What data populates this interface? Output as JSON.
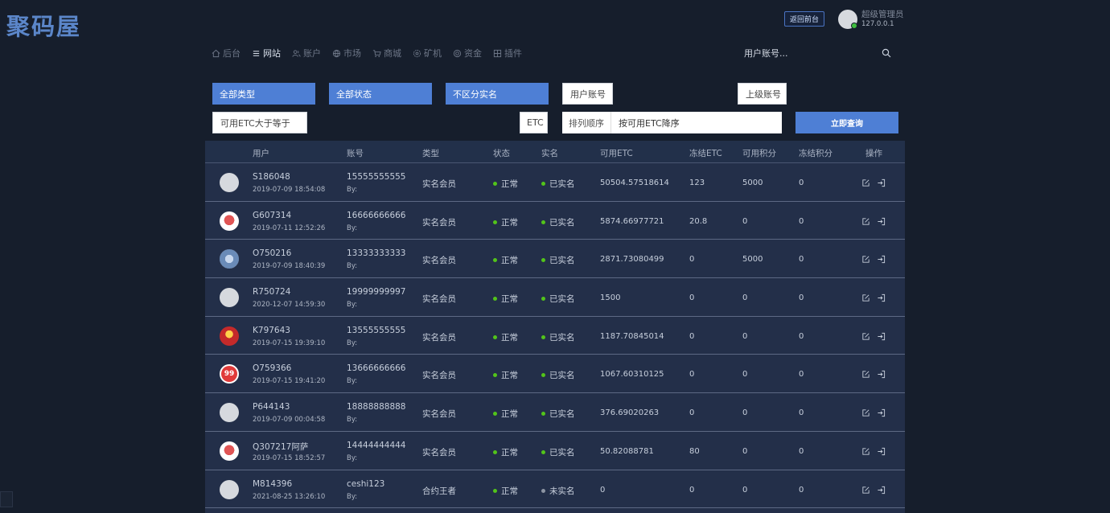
{
  "brand": {
    "logo": "聚码屋"
  },
  "header": {
    "back_button": "返回前台",
    "admin_name": "超级管理员",
    "admin_ip": "127.0.0.1"
  },
  "nav": {
    "items": [
      {
        "label": "后台",
        "icon": "home-icon",
        "active": false
      },
      {
        "label": "网站",
        "icon": "list-icon",
        "active": true
      },
      {
        "label": "账户",
        "icon": "users-icon",
        "active": false
      },
      {
        "label": "市场",
        "icon": "globe-icon",
        "active": false
      },
      {
        "label": "商城",
        "icon": "cart-icon",
        "active": false
      },
      {
        "label": "矿机",
        "icon": "gear-icon",
        "active": false
      },
      {
        "label": "资金",
        "icon": "coin-icon",
        "active": false
      },
      {
        "label": "插件",
        "icon": "grid-icon",
        "active": false
      }
    ],
    "user_search": "用户账号..."
  },
  "filters": {
    "type": "全部类型",
    "status": "全部状态",
    "realname": "不区分实名",
    "user_account_placeholder": "用户账号",
    "parent_account_placeholder": "上级账号",
    "etc_min_placeholder": "可用ETC大于等于",
    "etc_unit": "ETC",
    "sort_label": "排列顺序",
    "sort_value": "按可用ETC降序",
    "query_button": "立即查询"
  },
  "table": {
    "headers": {
      "user": "用户",
      "account": "账号",
      "type": "类型",
      "status": "状态",
      "realname": "实名",
      "etc": "可用ETC",
      "frozen_etc": "冻结ETC",
      "points": "可用积分",
      "frozen_points": "冻结积分",
      "actions": "操作"
    },
    "rows": [
      {
        "name": "S186048",
        "date": "2019-07-09 18:54:08",
        "account": "15555555555",
        "by": "By:",
        "type": "实名会员",
        "status": "正常",
        "realname": "已实名",
        "verified": true,
        "etc": "50504.57518614",
        "frozen": "123",
        "points": "5000",
        "fpoints": "0"
      },
      {
        "name": "G607314",
        "date": "2019-07-11 12:52:26",
        "account": "16666666666",
        "by": "By:",
        "type": "实名会员",
        "status": "正常",
        "realname": "已实名",
        "verified": true,
        "etc": "5874.66977721",
        "frozen": "20.8",
        "points": "0",
        "fpoints": "0"
      },
      {
        "name": "O750216",
        "date": "2019-07-09 18:40:39",
        "account": "13333333333",
        "by": "By:",
        "type": "实名会员",
        "status": "正常",
        "realname": "已实名",
        "verified": true,
        "etc": "2871.73080499",
        "frozen": "0",
        "points": "5000",
        "fpoints": "0"
      },
      {
        "name": "R750724",
        "date": "2020-12-07 14:59:30",
        "account": "19999999997",
        "by": "By:",
        "type": "实名会员",
        "status": "正常",
        "realname": "已实名",
        "verified": true,
        "etc": "1500",
        "frozen": "0",
        "points": "0",
        "fpoints": "0"
      },
      {
        "name": "K797643",
        "date": "2019-07-15 19:39:10",
        "account": "13555555555",
        "by": "By:",
        "type": "实名会员",
        "status": "正常",
        "realname": "已实名",
        "verified": true,
        "etc": "1187.70845014",
        "frozen": "0",
        "points": "0",
        "fpoints": "0"
      },
      {
        "name": "O759366",
        "date": "2019-07-15 19:41:20",
        "account": "13666666666",
        "by": "By:",
        "type": "实名会员",
        "status": "正常",
        "realname": "已实名",
        "verified": true,
        "etc": "1067.60310125",
        "frozen": "0",
        "points": "0",
        "fpoints": "0"
      },
      {
        "name": "P644143",
        "date": "2019-07-09 00:04:58",
        "account": "18888888888",
        "by": "By:",
        "type": "实名会员",
        "status": "正常",
        "realname": "已实名",
        "verified": true,
        "etc": "376.69020263",
        "frozen": "0",
        "points": "0",
        "fpoints": "0"
      },
      {
        "name": "Q307217阿萨",
        "date": "2019-07-15 18:52:57",
        "account": "14444444444",
        "by": "By:",
        "type": "实名会员",
        "status": "正常",
        "realname": "已实名",
        "verified": true,
        "etc": "50.82088781",
        "frozen": "80",
        "points": "0",
        "fpoints": "0"
      },
      {
        "name": "M814396",
        "date": "2021-08-25 13:26:10",
        "account": "ceshi123",
        "by": "By:",
        "type": "合约王者",
        "status": "正常",
        "realname": "未实名",
        "verified": false,
        "etc": "0",
        "frozen": "0",
        "points": "0",
        "fpoints": "0"
      }
    ]
  },
  "avatar_badge_text": "99",
  "colors": {
    "accent": "#4e7fd5",
    "ok_dot": "#52c41a",
    "muted_dot": "#8d95a3",
    "bg": "#161e2c",
    "table_bg": "#232f49"
  }
}
